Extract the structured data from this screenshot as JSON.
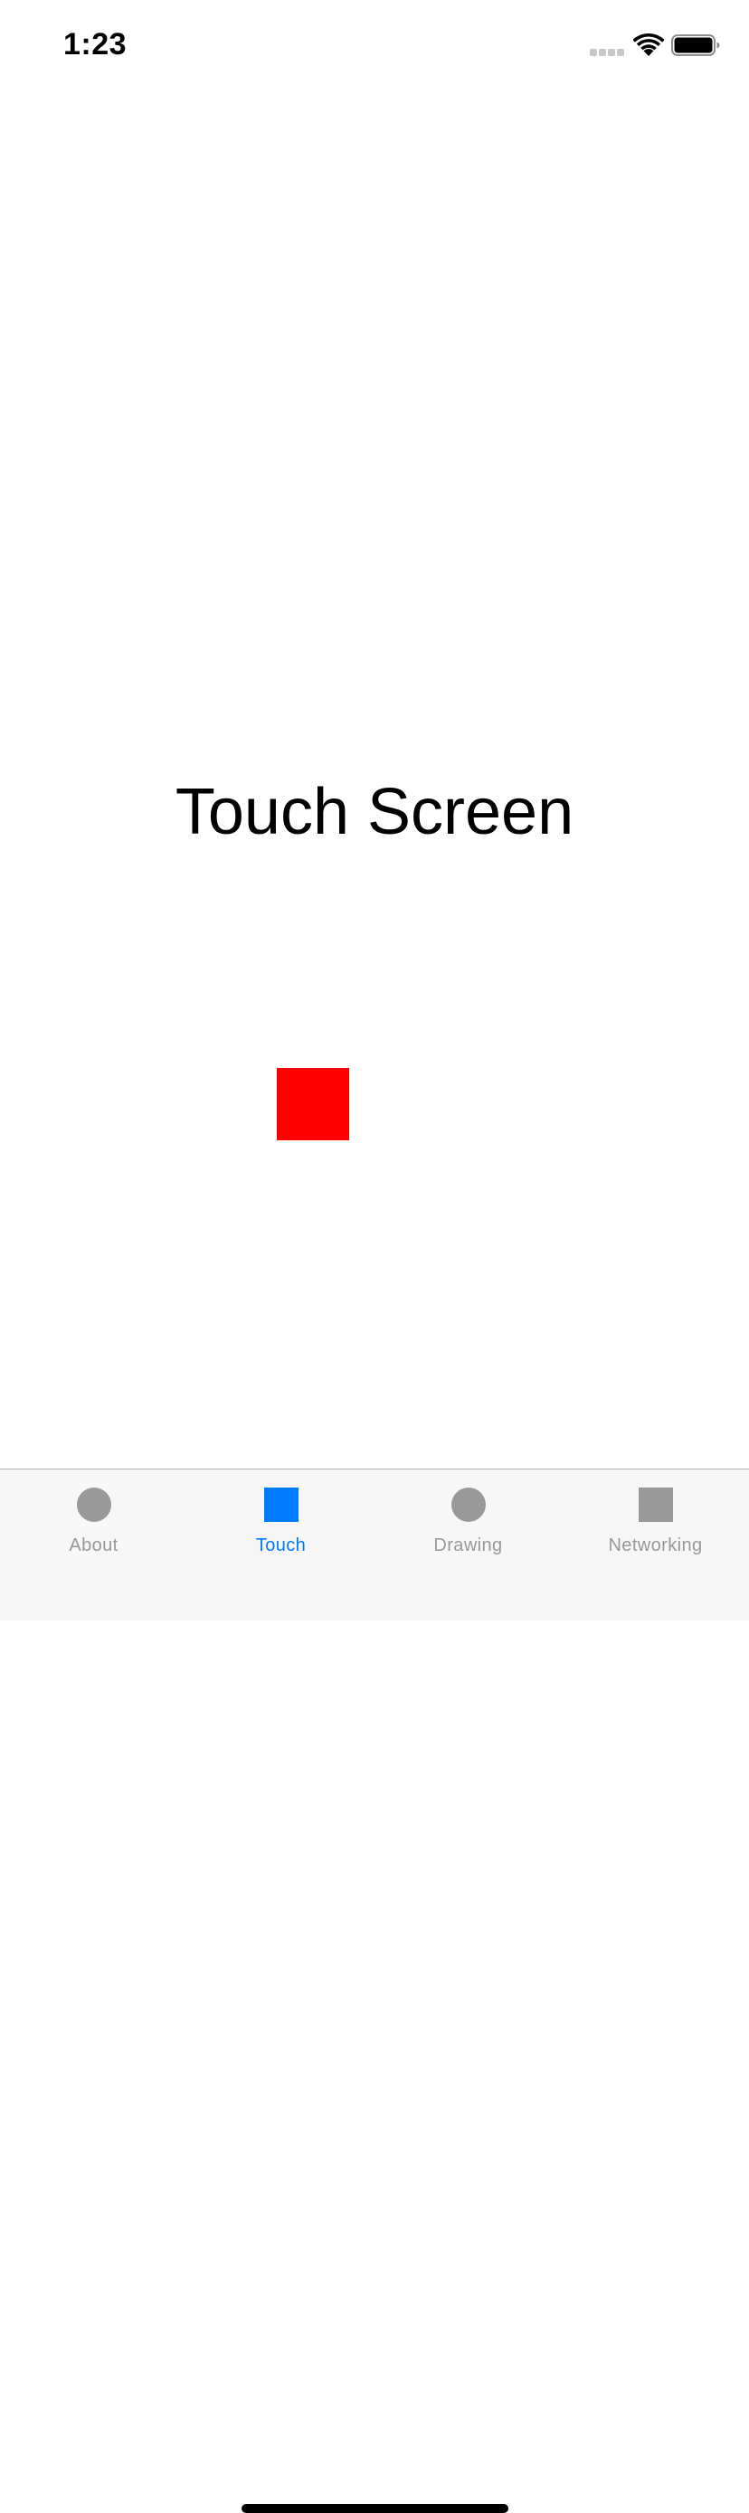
{
  "status_bar": {
    "time": "1:23"
  },
  "main": {
    "title": "Touch Screen",
    "touch_square_color": "#ff0000"
  },
  "tab_bar": {
    "active_color": "#007aff",
    "inactive_color": "#999999",
    "tabs": [
      {
        "label": "About",
        "icon": "circle-icon",
        "active": false
      },
      {
        "label": "Touch",
        "icon": "square-icon",
        "active": true
      },
      {
        "label": "Drawing",
        "icon": "circle-icon",
        "active": false
      },
      {
        "label": "Networking",
        "icon": "square-icon",
        "active": false
      }
    ]
  }
}
